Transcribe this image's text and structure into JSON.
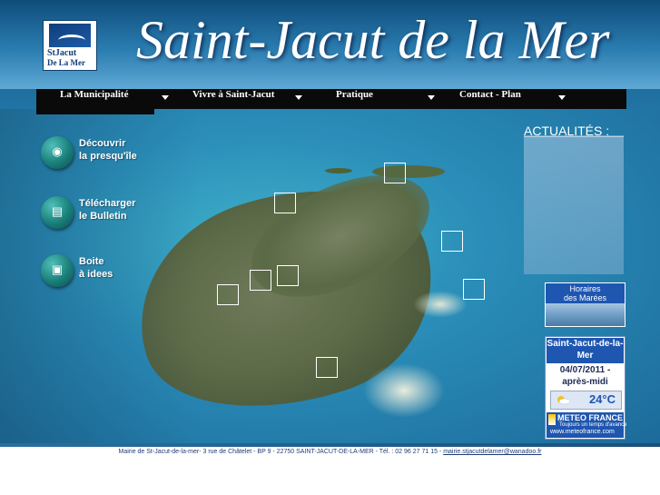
{
  "header": {
    "logo_line1": "StJacut",
    "logo_line2": "De La Mer",
    "title": "Saint-Jacut de la Mer"
  },
  "nav": {
    "items": [
      {
        "label": "La Municipalité"
      },
      {
        "label": "Vivre à Saint-Jacut"
      },
      {
        "label": "Pratique"
      },
      {
        "label": "Contact - Plan"
      }
    ]
  },
  "left_menu": {
    "items": [
      {
        "label": "Découvrir\nla presqu'île",
        "icon": "footprints-icon"
      },
      {
        "label": "Télécharger\nle Bulletin",
        "icon": "document-icon"
      },
      {
        "label": "Boite\nà idees",
        "icon": "box-icon"
      }
    ]
  },
  "news": {
    "title": "ACTUALITÉS :"
  },
  "tides": {
    "label_line1": "Horaires",
    "label_line2": "des Marées"
  },
  "meteo": {
    "city": "Saint-Jacut-de-la-Mer",
    "date": "04/07/2011 - après-midi",
    "temperature": "24°C",
    "brand": "METEO FRANCE",
    "tagline": "Toujours un temps d'avance",
    "url": "www.meteofrance.com"
  },
  "footer": {
    "address": "Mairie de St-Jacut-de-la-mer- 3 rue de Châtelet - BP 9 - 22750 SAINT-JACUT-DE-LA-MER - Tél. : 02 96 27 71 15 - ",
    "email": "mairie.stjacutdelamer@wanadoo.fr"
  },
  "colors": {
    "nav_bg": "#0a0a0a",
    "meteo_blue": "#1e56b0",
    "footer_text": "#1e3c78"
  }
}
